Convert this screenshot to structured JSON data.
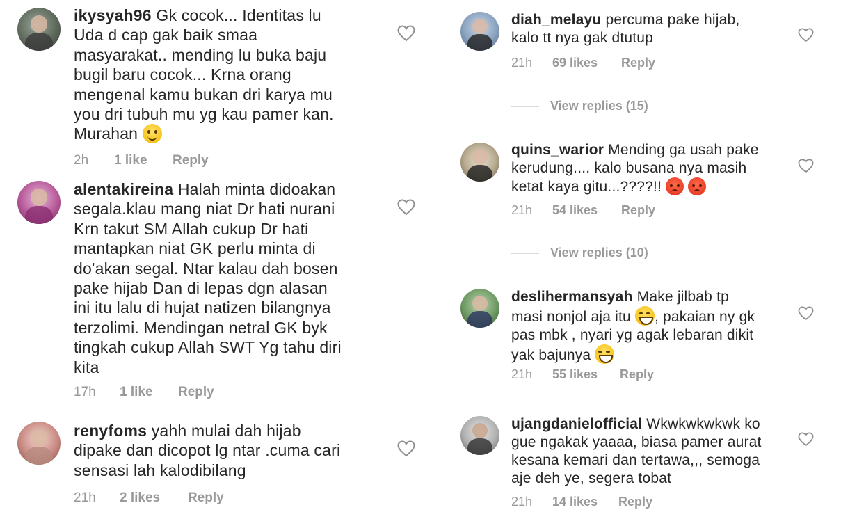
{
  "left_comments": [
    {
      "username": "ikysyah96",
      "text": "Gk cocok... Identitas lu\nUda d cap gak baik smaa\nmasyarakat.. mending lu buka baju\nbugil baru cocok... Krna orang\nmengenal kamu bukan dri karya mu\nyou dri tubuh mu yg kau pamer kan.\nMurahan ",
      "emoji": "smiling-face",
      "time": "2h",
      "likes": "1 like",
      "reply": "Reply"
    },
    {
      "username": "alentakireina",
      "text": "Halah minta didoakan\nsegala.klau mang niat Dr hati nurani\nKrn takut SM Allah cukup Dr hati\nmantapkan niat GK perlu minta di\ndo'akan segal. Ntar kalau dah bosen\npake hijab Dan di lepas dgn alasan\nini itu lalu di hujat natizen bilangnya\nterzolimi. Mendingan netral GK byk\ntingkah cukup Allah SWT Yg tahu diri\nkita",
      "time": "17h",
      "likes": "1 like",
      "reply": "Reply"
    },
    {
      "username": "renyfoms",
      "text": "yahh mulai dah hijab\ndipake dan dicopot lg ntar .cuma cari\nsensasi lah kalodibilang",
      "time": "21h",
      "likes": "2 likes",
      "reply": "Reply"
    }
  ],
  "right_comments": [
    {
      "username": "diah_melayu",
      "text": "percuma pake hijab,\nkalo tt nya gak dtutup",
      "time": "21h",
      "likes": "69 likes",
      "reply": "Reply",
      "view_replies": "View replies (15)"
    },
    {
      "username": "quins_warior",
      "text": "Mending ga usah pake\nkerudung.... kalo busana nya masih\nketat kaya gitu...????!! ",
      "emoji": "angry-face",
      "time": "21h",
      "likes": "54 likes",
      "reply": "Reply",
      "view_replies": "View replies (10)"
    },
    {
      "username": "deslihermansyah",
      "text_a": "Make jilbab tp\nmasi nonjol aja itu ",
      "text_b": ", pakaian ny gk\npas mbk , nyari yg agak lebaran dikit\nyak bajunya ",
      "emoji_a": "grinning-sweat-face",
      "emoji_b": "tears-of-joy-face",
      "time": "21h",
      "likes": "55 likes",
      "reply": "Reply"
    },
    {
      "username": "ujangdanielofficial",
      "text": "Wkwkwkwkwk ko\ngue ngakak yaaaa, biasa pamer aurat\nkesana kemari dan tertawa,,, semoga\naje deh ye, segera tobat",
      "time": "21h",
      "likes": "14 likes",
      "reply": "Reply"
    }
  ],
  "colors": {
    "text": "#262626",
    "meta": "#999999",
    "divider": "#dbdbdb"
  }
}
